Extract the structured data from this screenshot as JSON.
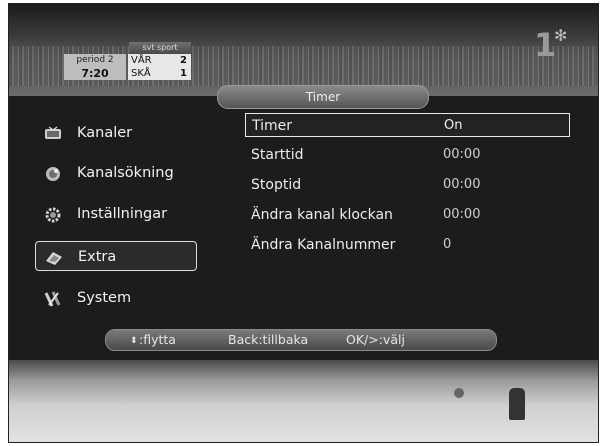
{
  "broadcast": {
    "channel_logo": "1",
    "scorebug": {
      "header": "svt sport",
      "period_label": "period 2",
      "clock": "7:20",
      "teams": [
        {
          "name": "VÅR",
          "score": "2"
        },
        {
          "name": "SKÅ",
          "score": "1"
        }
      ]
    }
  },
  "osd": {
    "title": "Timer",
    "sidebar": {
      "items": [
        {
          "label": "Kanaler",
          "icon": "tv-channels-icon",
          "selected": false
        },
        {
          "label": "Kanalsökning",
          "icon": "satellite-search-icon",
          "selected": false
        },
        {
          "label": "Inställningar",
          "icon": "settings-gear-icon",
          "selected": false
        },
        {
          "label": "Extra",
          "icon": "extra-icon",
          "selected": true
        },
        {
          "label": "System",
          "icon": "system-tools-icon",
          "selected": false
        }
      ]
    },
    "timer_settings": {
      "rows": [
        {
          "label": "Timer",
          "value": "On",
          "selected": true
        },
        {
          "label": "Starttid",
          "value": "00:00",
          "selected": false
        },
        {
          "label": "Stoptid",
          "value": "00:00",
          "selected": false
        },
        {
          "label": "Ändra kanal klockan",
          "value": "00:00",
          "selected": false
        },
        {
          "label": "Ändra Kanalnummer",
          "value": "0",
          "selected": false
        }
      ]
    },
    "help_bar": {
      "move_icon": "up-down-arrows-icon",
      "move": ":flytta",
      "back": "Back:tillbaka",
      "ok": "OK/>:välj"
    }
  },
  "colors": {
    "osd_background": "#1c1c1c",
    "selection_border": "#e8e8e8"
  }
}
